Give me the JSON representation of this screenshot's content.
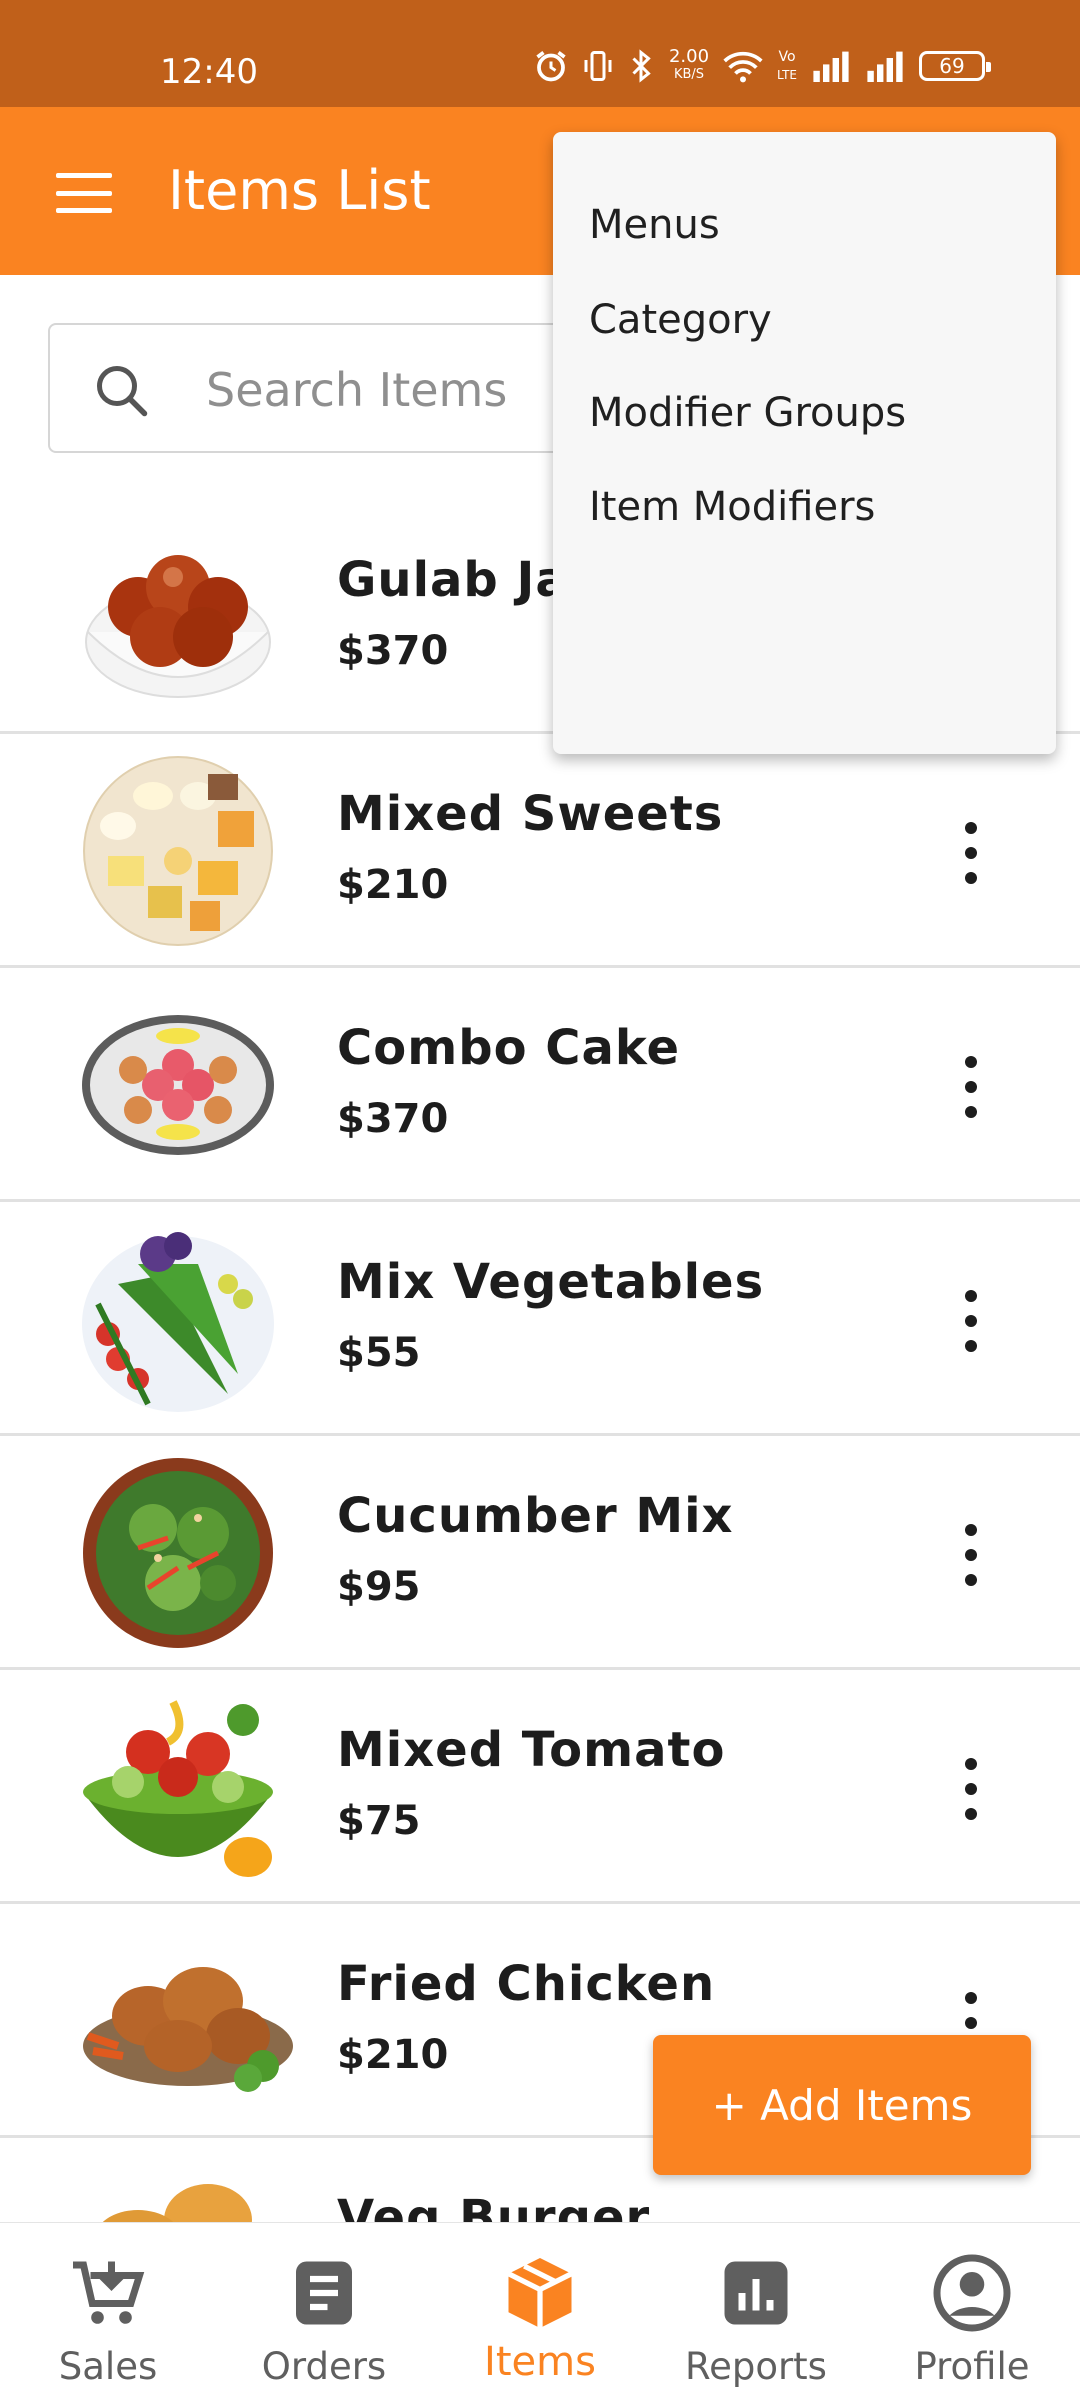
{
  "status_bar": {
    "time": "12:40",
    "speed_value": "2.00",
    "speed_unit": "KB/S",
    "volte_top": "Vo",
    "volte_bottom": "LTE",
    "battery": "69"
  },
  "app_bar": {
    "title": "Items List",
    "menu_icon": "hamburger-icon"
  },
  "search": {
    "placeholder": "Search Items",
    "value": "",
    "icon": "search-icon"
  },
  "items": [
    {
      "name": "Gulab Ja",
      "price": "$370",
      "image": "gulab-jamun-image"
    },
    {
      "name": "Mixed Sweets",
      "price": "$210",
      "image": "mixed-sweets-image"
    },
    {
      "name": "Combo Cake",
      "price": "$370",
      "image": "combo-cake-image"
    },
    {
      "name": "Mix Vegetables",
      "price": "$55",
      "image": "mix-vegetables-image"
    },
    {
      "name": "Cucumber Mix",
      "price": "$95",
      "image": "cucumber-mix-image"
    },
    {
      "name": "Mixed Tomato",
      "price": "$75",
      "image": "mixed-tomato-image"
    },
    {
      "name": "Fried Chicken",
      "price": "$210",
      "image": "fried-chicken-image"
    },
    {
      "name": "Veg Burger",
      "price": "",
      "image": "veg-burger-image"
    }
  ],
  "popup_menu": {
    "items": [
      "Menus",
      "Category",
      "Modifier Groups",
      "Item Modifiers"
    ]
  },
  "fab": {
    "label": "+ Add Items"
  },
  "bottom_nav": {
    "items": [
      {
        "label": "Sales",
        "icon": "cart-icon"
      },
      {
        "label": "Orders",
        "icon": "document-icon"
      },
      {
        "label": "Items",
        "icon": "box-icon"
      },
      {
        "label": "Reports",
        "icon": "chart-icon"
      },
      {
        "label": "Profile",
        "icon": "profile-icon"
      }
    ],
    "active_index": 2
  },
  "colors": {
    "primary": "#fa8321",
    "status_bar": "#c0601a",
    "text_dark": "#1d1d1d",
    "nav_inactive": "#5f5f5f"
  }
}
